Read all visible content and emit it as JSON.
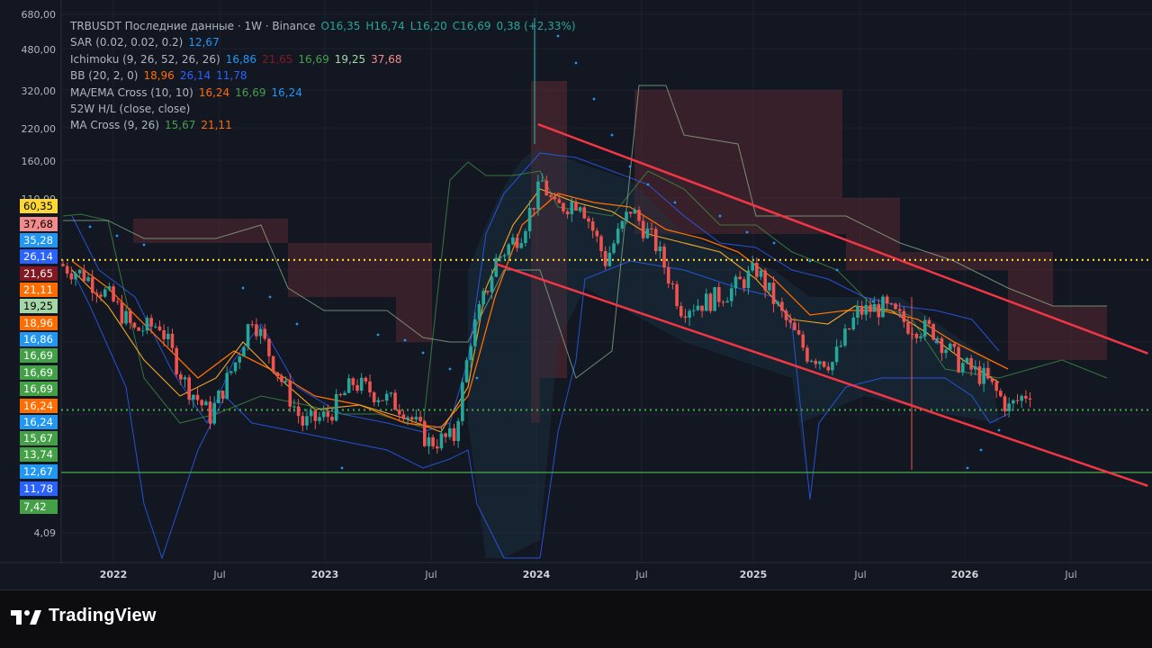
{
  "legend": {
    "main": {
      "symbol": "TRBUSDT Последние данные · 1W · Binance",
      "open": "O16,35",
      "high": "H16,74",
      "low": "L16,20",
      "close": "C16,69",
      "change": "0,38 (+2,33%)"
    },
    "indicators": [
      {
        "name": "SAR (0.02, 0.02, 0.2)",
        "values": [
          {
            "text": "12,67",
            "color": "#2196f3"
          }
        ]
      },
      {
        "name": "Ichimoku (9, 26, 52, 26, 26)",
        "values": [
          {
            "text": "16,86",
            "color": "#2196f3"
          },
          {
            "text": "21,65",
            "color": "#801922"
          },
          {
            "text": "16,69",
            "color": "#43a047"
          },
          {
            "text": "19,25",
            "color": "#a5d6a7"
          },
          {
            "text": "37,68",
            "color": "#f28b8b"
          }
        ]
      },
      {
        "name": "BB (20, 2, 0)",
        "values": [
          {
            "text": "18,96",
            "color": "#ff6d00"
          },
          {
            "text": "26,14",
            "color": "#2962ff"
          },
          {
            "text": "11,78",
            "color": "#2962ff"
          }
        ]
      },
      {
        "name": "MA/EMA Cross (10, 10)",
        "values": [
          {
            "text": "16,24",
            "color": "#ff6d00"
          },
          {
            "text": "16,69",
            "color": "#43a047"
          },
          {
            "text": "16,24",
            "color": "#2196f3"
          }
        ]
      },
      {
        "name": "52W H/L (close, close)",
        "values": []
      },
      {
        "name": "MA Cross (9, 26)",
        "values": [
          {
            "text": "15,67",
            "color": "#43a047"
          },
          {
            "text": "21,11",
            "color": "#ff6d00"
          }
        ]
      }
    ]
  },
  "axis": {
    "y_ticks": [
      "680,00",
      "480,00",
      "320,00",
      "220,00",
      "160,00",
      "110,00",
      "4,09"
    ],
    "x_ticks": [
      {
        "label": "2022",
        "bold": true
      },
      {
        "label": "Jul",
        "bold": false
      },
      {
        "label": "2023",
        "bold": true
      },
      {
        "label": "Jul",
        "bold": false
      },
      {
        "label": "2024",
        "bold": true
      },
      {
        "label": "Jul",
        "bold": false
      },
      {
        "label": "2025",
        "bold": true
      },
      {
        "label": "Jul",
        "bold": false
      },
      {
        "label": "2026",
        "bold": true
      },
      {
        "label": "Jul",
        "bold": false
      }
    ]
  },
  "price_badges": [
    {
      "text": "60,35",
      "bg": "#fdd835",
      "fg": "#000000"
    },
    {
      "text": "37,68",
      "bg": "#f28b8b",
      "fg": "#000000"
    },
    {
      "text": "35,28",
      "bg": "#2196f3",
      "fg": "#ffffff"
    },
    {
      "text": "26,14",
      "bg": "#2962ff",
      "fg": "#ffffff"
    },
    {
      "text": "21,65",
      "bg": "#801922",
      "fg": "#ffffff"
    },
    {
      "text": "21,11",
      "bg": "#ff6d00",
      "fg": "#ffffff"
    },
    {
      "text": "19,25",
      "bg": "#a5d6a7",
      "fg": "#000000"
    },
    {
      "text": "18,96",
      "bg": "#ff6d00",
      "fg": "#ffffff"
    },
    {
      "text": "16,86",
      "bg": "#2196f3",
      "fg": "#ffffff"
    },
    {
      "text": "16,69",
      "bg": "#43a047",
      "fg": "#ffffff"
    },
    {
      "text": "16,69",
      "bg": "#43a047",
      "fg": "#ffffff"
    },
    {
      "text": "16,69",
      "bg": "#43a047",
      "fg": "#ffffff"
    },
    {
      "text": "16,24",
      "bg": "#ff6d00",
      "fg": "#ffffff"
    },
    {
      "text": "16,24",
      "bg": "#2196f3",
      "fg": "#ffffff"
    },
    {
      "text": "15,67",
      "bg": "#43a047",
      "fg": "#ffffff"
    },
    {
      "text": "13,74",
      "bg": "#43a047",
      "fg": "#ffffff"
    },
    {
      "text": "12,67",
      "bg": "#2196f3",
      "fg": "#ffffff"
    },
    {
      "text": "11,78",
      "bg": "#2962ff",
      "fg": "#ffffff"
    },
    {
      "text": "7,42",
      "bg": "#43a047",
      "fg": "#ffffff"
    }
  ],
  "branding": {
    "logo_text": "TradingView"
  },
  "colors": {
    "up": "#26a69a",
    "down": "#ef5350",
    "trendline": "#f23645",
    "level_yellow": "#fdd835",
    "level_green": "#43a047",
    "cloud_bear": "#5d2a32",
    "cloud_bull": "#1e3a4a"
  },
  "chart_data": {
    "type": "candlestick",
    "title": "TRBUSDT Последние данные · 1W · Binance",
    "scale": "log",
    "ylim": [
      3.5,
      680
    ],
    "y_ticks": [
      680,
      480,
      320,
      220,
      160,
      110,
      4.09
    ],
    "x_range": [
      "2021-10",
      "2026-09"
    ],
    "grid": true,
    "last": {
      "open": 16.35,
      "high": 16.74,
      "low": 16.2,
      "close": 16.69,
      "change": 0.38,
      "change_pct": 2.33
    },
    "close_series": [
      {
        "date": "2021-10-04",
        "close": 58
      },
      {
        "date": "2021-11-15",
        "close": 52
      },
      {
        "date": "2021-12-27",
        "close": 42
      },
      {
        "date": "2022-02-07",
        "close": 30
      },
      {
        "date": "2022-03-21",
        "close": 32
      },
      {
        "date": "2022-05-02",
        "close": 18
      },
      {
        "date": "2022-06-13",
        "close": 13
      },
      {
        "date": "2022-07-25",
        "close": 22
      },
      {
        "date": "2022-08-22",
        "close": 35
      },
      {
        "date": "2022-10-03",
        "close": 20
      },
      {
        "date": "2022-11-14",
        "close": 12
      },
      {
        "date": "2022-12-26",
        "close": 13
      },
      {
        "date": "2023-02-06",
        "close": 18
      },
      {
        "date": "2023-03-20",
        "close": 16
      },
      {
        "date": "2023-05-01",
        "close": 14
      },
      {
        "date": "2023-06-12",
        "close": 10
      },
      {
        "date": "2023-07-24",
        "close": 10.5
      },
      {
        "date": "2023-08-21",
        "close": 28
      },
      {
        "date": "2023-10-02",
        "close": 60
      },
      {
        "date": "2023-11-13",
        "close": 80
      },
      {
        "date": "2023-12-18",
        "close": 130
      },
      {
        "date": "2024-01-08",
        "close": 100
      },
      {
        "date": "2024-02-19",
        "close": 110
      },
      {
        "date": "2024-04-01",
        "close": 60
      },
      {
        "date": "2024-05-13",
        "close": 100
      },
      {
        "date": "2024-06-24",
        "close": 70
      },
      {
        "date": "2024-08-05",
        "close": 38
      },
      {
        "date": "2024-09-16",
        "close": 40
      },
      {
        "date": "2024-10-28",
        "close": 45
      },
      {
        "date": "2024-12-09",
        "close": 55
      },
      {
        "date": "2025-01-20",
        "close": 35
      },
      {
        "date": "2025-03-03",
        "close": 24
      },
      {
        "date": "2025-04-14",
        "close": 22
      },
      {
        "date": "2025-05-26",
        "close": 36
      },
      {
        "date": "2025-07-07",
        "close": 38
      },
      {
        "date": "2025-08-18",
        "close": 32
      },
      {
        "date": "2025-09-29",
        "close": 30
      },
      {
        "date": "2025-11-10",
        "close": 22
      },
      {
        "date": "2025-12-22",
        "close": 19
      },
      {
        "date": "2026-02-02",
        "close": 14
      },
      {
        "date": "2026-03-09",
        "close": 16.69
      }
    ],
    "levels": [
      {
        "name": "resistance",
        "value": 60.35,
        "style": "dotted",
        "color": "#fdd835"
      },
      {
        "name": "support",
        "value": 13.74,
        "style": "dotted",
        "color": "#43a047"
      },
      {
        "name": "bottom",
        "value": 7.42,
        "style": "solid",
        "color": "#43a047"
      }
    ],
    "trendlines": [
      {
        "from": {
          "date": "2023-12-04",
          "value": 230
        },
        "to": {
          "date": "2026-09-14",
          "value": 24
        }
      },
      {
        "from": {
          "date": "2023-09-25",
          "value": 58
        },
        "to": {
          "date": "2026-09-14",
          "value": 6.5
        }
      }
    ]
  }
}
